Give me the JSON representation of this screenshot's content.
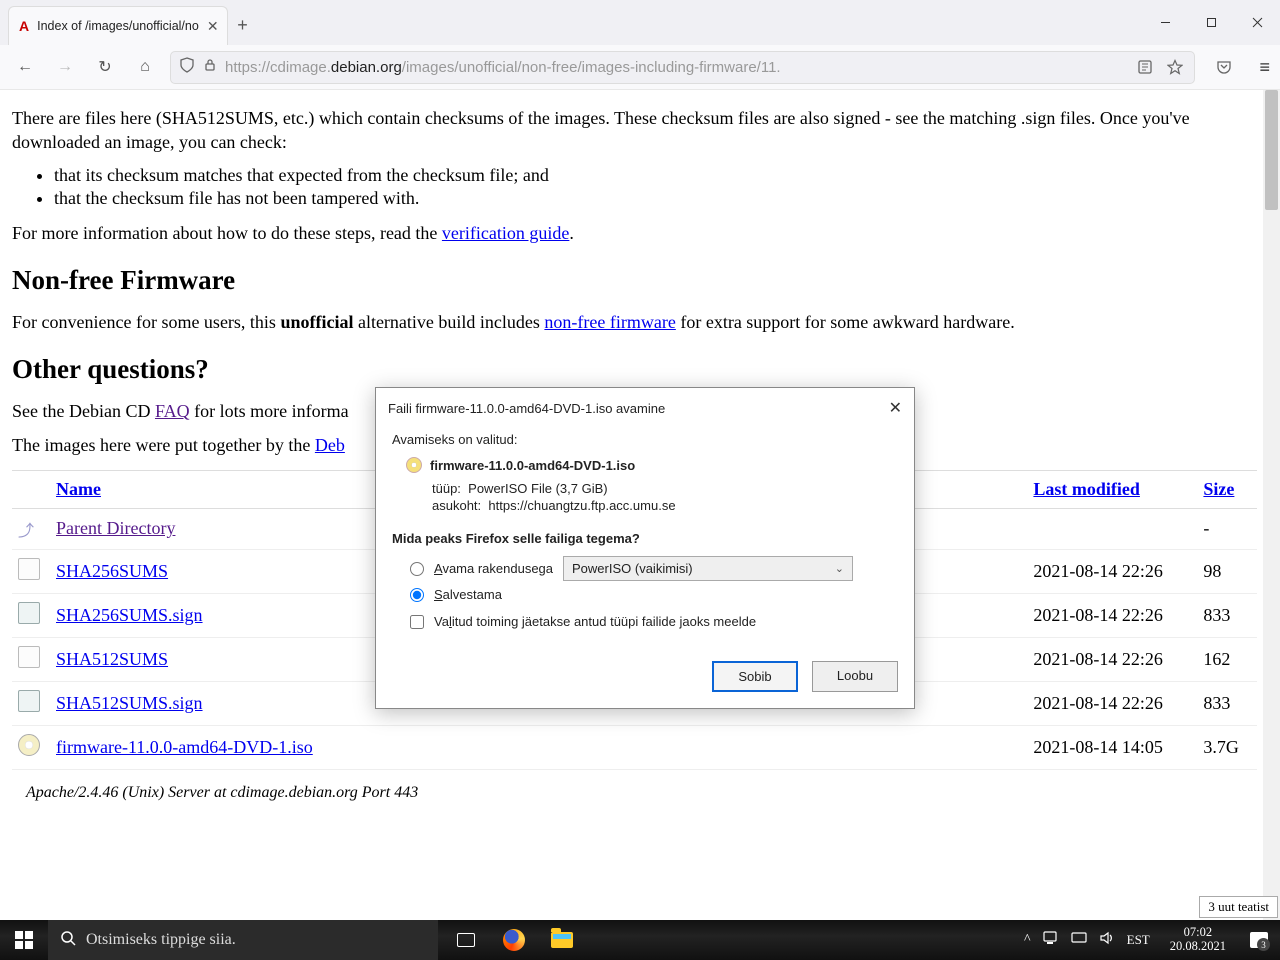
{
  "browser": {
    "tab_title": "Index of /images/unofficial/no",
    "url_pre": "https://cdimage.",
    "url_host": "debian.org",
    "url_post": "/images/unofficial/non-free/images-including-firmware/11."
  },
  "page": {
    "p1": "There are files here (SHA512SUMS, etc.) which contain checksums of the images. These checksum files are also signed - see the matching .sign files. Once you've downloaded an image, you can check:",
    "li1": "that its checksum matches that expected from the checksum file; and",
    "li2": "that the checksum file has not been tampered with.",
    "p2a": "For more information about how to do these steps, read the ",
    "p2_link": "verification guide",
    "p2b": ".",
    "h2a": "Non-free Firmware",
    "p3a": "For convenience for some users, this ",
    "p3_bold": "unofficial",
    "p3b": " alternative build includes ",
    "p3_link": "non-free firmware",
    "p3c": " for extra support for some awkward hardware.",
    "h2b": "Other questions?",
    "p4a": "See the Debian CD ",
    "p4_link": "FAQ",
    "p4b": " for lots more informa",
    "p5a": "The images here were put together by the ",
    "p5_link": "Deb",
    "table": {
      "headers": {
        "name": "Name",
        "modified": "Last modified",
        "size": "Size"
      },
      "rows": [
        {
          "icon": "back",
          "name": "Parent Directory",
          "visited": true,
          "modified": "",
          "size": "-"
        },
        {
          "icon": "file",
          "name": "SHA256SUMS",
          "modified": "2021-08-14 22:26",
          "size": "98"
        },
        {
          "icon": "sign",
          "name": "SHA256SUMS.sign",
          "modified": "2021-08-14 22:26",
          "size": "833"
        },
        {
          "icon": "file",
          "name": "SHA512SUMS",
          "modified": "2021-08-14 22:26",
          "size": "162"
        },
        {
          "icon": "sign",
          "name": "SHA512SUMS.sign",
          "modified": "2021-08-14 22:26",
          "size": "833"
        },
        {
          "icon": "disc",
          "name": "firmware-11.0.0-amd64-DVD-1.iso",
          "modified": "2021-08-14 14:05",
          "size": "3.7G"
        }
      ]
    },
    "server": "Apache/2.4.46 (Unix) Server at cdimage.debian.org Port 443"
  },
  "dialog": {
    "title": "Faili firmware-11.0.0-amd64-DVD-1.iso avamine",
    "sub": "Avamiseks on valitud:",
    "filename": "firmware-11.0.0-amd64-DVD-1.iso",
    "type_label": "tüüp:",
    "type_value": "PowerISO File (3,7 GiB)",
    "loc_label": "asukoht:",
    "loc_value": "https://chuangtzu.ftp.acc.umu.se",
    "question": "Mida peaks Firefox selle failiga tegema?",
    "open_label_pre": "",
    "open_label_key": "A",
    "open_label_post": "vama rakendusega",
    "open_app": "PowerISO (vaikimisi)",
    "save_label_pre": "",
    "save_label_key": "S",
    "save_label_post": "alvestama",
    "remember_pre": "Va",
    "remember_key": "l",
    "remember_post": "itud toiming jäetakse antud tüüpi failide jaoks meelde",
    "ok": "Sobib",
    "cancel": "Loobu"
  },
  "toast": "3 uut teatist",
  "taskbar": {
    "search_placeholder": "Otsimiseks tippige siia.",
    "lang": "EST",
    "time": "07:02",
    "date": "20.08.2021",
    "notif_count": "3"
  }
}
